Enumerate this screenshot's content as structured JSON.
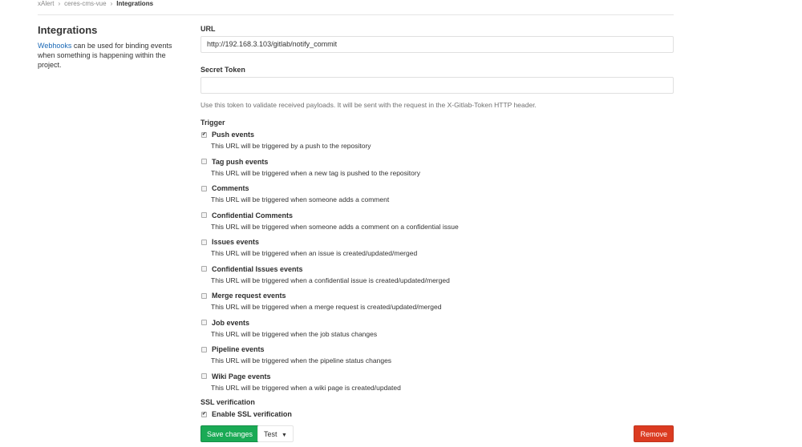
{
  "breadcrumb": [
    "xAlert",
    "ceres-cms-vue",
    "Integrations"
  ],
  "sidebar": {
    "title": "Integrations",
    "link": "Webhooks",
    "text": " can be used for binding events when something is happening within the project."
  },
  "form": {
    "url_label": "URL",
    "url_value": "http://192.168.3.103/gitlab/notify_commit",
    "token_label": "Secret Token",
    "token_value": "",
    "token_help": "Use this token to validate received payloads. It will be sent with the request in the X-Gitlab-Token HTTP header.",
    "trigger_label": "Trigger",
    "triggers": [
      {
        "label": "Push events",
        "desc": "This URL will be triggered by a push to the repository",
        "checked": true
      },
      {
        "label": "Tag push events",
        "desc": "This URL will be triggered when a new tag is pushed to the repository",
        "checked": false
      },
      {
        "label": "Comments",
        "desc": "This URL will be triggered when someone adds a comment",
        "checked": false
      },
      {
        "label": "Confidential Comments",
        "desc": "This URL will be triggered when someone adds a comment on a confidential issue",
        "checked": false
      },
      {
        "label": "Issues events",
        "desc": "This URL will be triggered when an issue is created/updated/merged",
        "checked": false
      },
      {
        "label": "Confidential Issues events",
        "desc": "This URL will be triggered when a confidential issue is created/updated/merged",
        "checked": false
      },
      {
        "label": "Merge request events",
        "desc": "This URL will be triggered when a merge request is created/updated/merged",
        "checked": false
      },
      {
        "label": "Job events",
        "desc": "This URL will be triggered when the job status changes",
        "checked": false
      },
      {
        "label": "Pipeline events",
        "desc": "This URL will be triggered when the pipeline status changes",
        "checked": false
      },
      {
        "label": "Wiki Page events",
        "desc": "This URL will be triggered when a wiki page is created/updated",
        "checked": false
      }
    ],
    "ssl_label": "SSL verification",
    "ssl_option": "Enable SSL verification",
    "ssl_checked": true
  },
  "buttons": {
    "save": "Save changes",
    "test": "Test",
    "remove": "Remove"
  }
}
